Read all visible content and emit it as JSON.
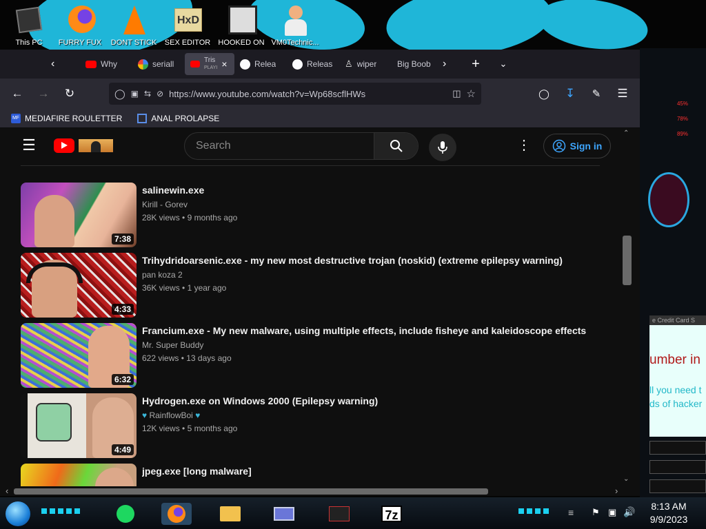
{
  "desktop": {
    "icons": [
      {
        "label": "This PC",
        "icon": "computer-icon"
      },
      {
        "label": "FURRY FUX",
        "icon": "firefox-icon"
      },
      {
        "label": "DONT STICK",
        "icon": "vlc-icon"
      },
      {
        "label": "SEX EDITOR",
        "icon": "hxd-editor-icon"
      },
      {
        "label": "HOOKED ON",
        "icon": "app-icon"
      },
      {
        "label": "VM0Technic...",
        "icon": "user-doctor-icon"
      }
    ]
  },
  "browser": {
    "tabs": [
      {
        "label": "Why",
        "icon": "youtube-icon"
      },
      {
        "label": "seriall",
        "icon": "google-icon"
      },
      {
        "label": "Tris",
        "sublabel": "PLAYI",
        "icon": "youtube-icon",
        "active": true
      },
      {
        "label": "Relea",
        "icon": "github-icon"
      },
      {
        "label": "Releas",
        "icon": "github-icon"
      },
      {
        "label": "wiper",
        "icon": "wiper-icon"
      },
      {
        "label": "Big Boob",
        "icon": "page-icon"
      }
    ],
    "url": "https://www.youtube.com/watch?v=Wp68scflHWs",
    "bookmarks": [
      {
        "label": "MEDIAFIRE ROULETTER",
        "icon": "mediafire-icon"
      },
      {
        "label": "ANAL PROLAPSE",
        "icon": "bookmark-icon"
      }
    ]
  },
  "youtube": {
    "search_placeholder": "Search",
    "signin_label": "Sign in",
    "videos": [
      {
        "title": "salinewin.exe",
        "channel": "Kirill - Gorev",
        "views": "28K views",
        "age": "9 months ago",
        "duration": "7:38",
        "badge": false
      },
      {
        "title": "Trihydridoarsenic.exe - my new most destructive trojan (noskid) (extreme epilepsy warning)",
        "channel": "pan koza 2",
        "views": "36K views",
        "age": "1 year ago",
        "duration": "4:33",
        "badge": false
      },
      {
        "title": "Francium.exe - My new malware, using multiple effects, include fisheye and kaleidoscope effects",
        "channel": "Mr. Super Buddy",
        "views": "622 views",
        "age": "13 days ago",
        "duration": "6:32",
        "badge": false
      },
      {
        "title": "Hydrogen.exe on Windows 2000 (Epilepsy warning)",
        "channel": "RainflowBoi",
        "views": "12K views",
        "age": "5 months ago",
        "duration": "4:49",
        "badge": true
      },
      {
        "title": "jpeg.exe [long malware]",
        "channel": "",
        "views": "",
        "age": "",
        "duration": "",
        "badge": false
      }
    ]
  },
  "sidebar_right": {
    "gauges": [
      "45%",
      "78%",
      "89%"
    ],
    "credit_tab": "e Credit Card S",
    "big_text": "umber in",
    "text_lines": [
      "ll you need t",
      "ds of hacker"
    ]
  },
  "taskbar": {
    "time": "8:13 AM",
    "date": "9/9/2023",
    "sevenzip_label": "7z"
  }
}
